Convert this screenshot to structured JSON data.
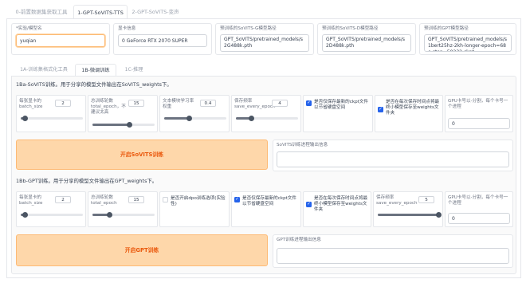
{
  "top_tabs": [
    "0-前置数据集获取工具",
    "1-GPT-SoVITS-TTS",
    "2-GPT-SoVITS-变声"
  ],
  "header": {
    "exp_name_label": "*实验/模型名",
    "exp_name_value": "yuqian",
    "gpu_info_label": "显卡信息",
    "gpu_info_value": "0 GeForce RTX 2070 SUPER",
    "sovits_g_label": "预训练的SoVITS-G模型路径",
    "sovits_g_value": "GPT_SoVITS/pretrained_models/s2G488k.pth",
    "sovits_d_label": "预训练的SoVITS-D模型路径",
    "sovits_d_value": "GPT_SoVITS/pretrained_models/s2D488k.pth",
    "gpt_label": "预训练的GPT模型路径",
    "gpt_value": "GPT_SoVITS/pretrained_models/s1bert25hz-2kh-longer-epoch=68e-step=50232.ckpt"
  },
  "sub_tabs": [
    "1A-训练集格式化工具",
    "1B-微调训练",
    "1C-推理"
  ],
  "sovits": {
    "title": "1Ba-SoVITS训练。用于分享的模型文件输出在SoVITS_weights下。",
    "batch_label": "每张显卡的batch_size",
    "batch_value": "2",
    "batch_level": 0.07,
    "epoch_label": "总训练轮数total_epoch，不建议太高",
    "epoch_value": "15",
    "epoch_level": 0.6,
    "lr_label": "文本模块学习率权重",
    "lr_value": "0.4",
    "lr_level": 0.4,
    "save_label": "保存频率save_every_epoch",
    "save_value": "4",
    "save_level": 0.25,
    "latest_ckpt_label": "是否仅保存最新的ckpt文件以节省硬盘空间",
    "weights_label": "是否在每次保存时间点将最终小模型保存至weights文件夹",
    "gpu_label": "GPU卡号以-分割，每个卡号一个进程",
    "gpu_value": "0",
    "button": "开启SoVITS训练",
    "output_label": "SoVITS训练进程输出信息"
  },
  "gpt": {
    "title": "1Bb-GPT训练。用于分享的模型文件输出在GPT_weights下。",
    "batch_label": "每张显卡的batch_size",
    "batch_value": "2",
    "batch_level": 0.07,
    "epoch_label": "总训练轮数total_epoch",
    "epoch_value": "15",
    "epoch_level": 0.27,
    "dpo_label": "是否开启dpo训练选项(实验性)",
    "latest_ckpt_label": "是否仅保存最新的ckpt文件以节省硬盘空间",
    "weights_label": "是否在每次保存时间点将最终小模型保存至weights文件夹",
    "save_label": "保存频率save_every_epoch",
    "save_value": "5",
    "save_level": 0.98,
    "gpu_label": "GPU卡号以-分割，每个卡号一个进程",
    "gpu_value": "0",
    "button": "开启GPT训练",
    "output_label": "GPT训练进程输出信息"
  }
}
